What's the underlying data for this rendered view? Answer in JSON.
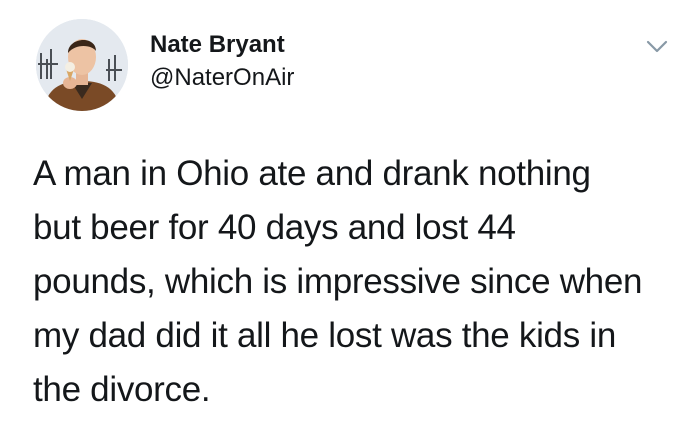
{
  "author": {
    "display_name": "Nate Bryant",
    "handle": "@NaterOnAir"
  },
  "icons": {
    "avatar": "profile-photo",
    "menu": "chevron-down-icon"
  },
  "tweet": {
    "lines": [
      "A man in Ohio ate and drank nothing",
      "but beer for 40 days and lost 44",
      "pounds, which is impressive since when",
      "my dad did it all he lost was the kids in",
      "the divorce."
    ]
  },
  "colors": {
    "text": "#14171a",
    "caret": "#8899a6",
    "background": "#ffffff"
  }
}
